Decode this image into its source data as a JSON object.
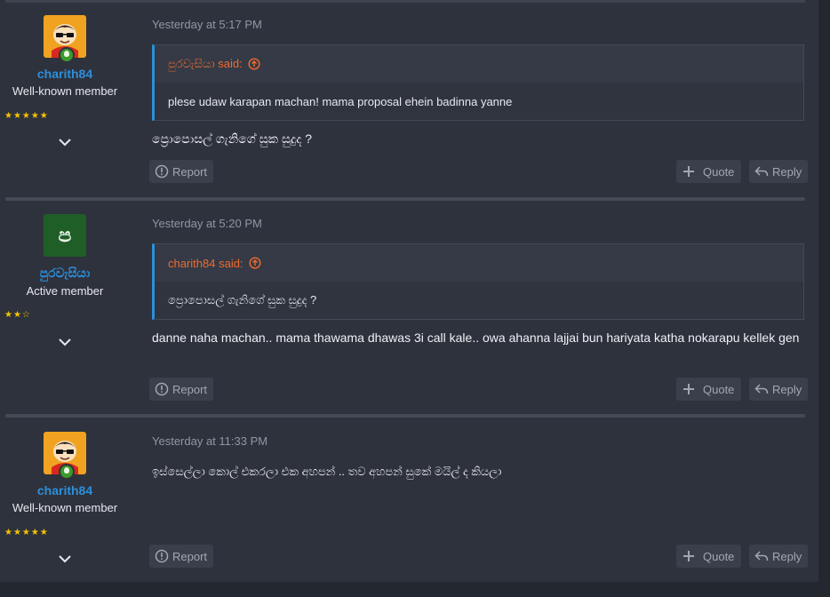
{
  "colors": {
    "accent": "#2d8fd9",
    "quote_author": "#f06a2c",
    "stars": "#f7c300"
  },
  "posts": [
    {
      "user": {
        "name": "charith84",
        "title": "Well-known member",
        "stars": "★★★★★",
        "avatar": "cartoon-avatar",
        "online": true
      },
      "date": "Yesterday at 5:17 PM",
      "quote": {
        "author": "පුරවැසියා said:",
        "text": "plese udaw karapan machan! mama proposal ehein badinna yanne"
      },
      "message": "ප්‍රොපොසල් ගැනිගේ සුක සුදුද ?",
      "actions": {
        "report": "Report",
        "quote": "Quote",
        "reply": "Reply"
      }
    },
    {
      "user": {
        "name": "පුරවැසියා",
        "title": "Active member",
        "stars": "★★☆",
        "avatar_letter": "ප",
        "online": false
      },
      "date": "Yesterday at 5:20 PM",
      "quote": {
        "author": "charith84 said:",
        "text": "ප්‍රොපොසල් ගැනිගේ සුක සුදුද ?"
      },
      "message": "danne naha machan.. mama thawama dhawas 3i call kale.. owa ahanna lajjai bun hariyata katha nokarapu kellek gen",
      "actions": {
        "report": "Report",
        "quote": "Quote",
        "reply": "Reply"
      }
    },
    {
      "user": {
        "name": "charith84",
        "title": "Well-known member",
        "stars": "★★★★★",
        "avatar": "cartoon-avatar",
        "online": true
      },
      "date": "Yesterday at 11:33 PM",
      "message": "ඉස්සෙල්ලා කොල් එකරලා එක අහපන් .. තව අහපන් සුකේ මයිල් ද කියලා",
      "actions": {
        "report": "Report",
        "quote": "Quote",
        "reply": "Reply"
      }
    }
  ]
}
